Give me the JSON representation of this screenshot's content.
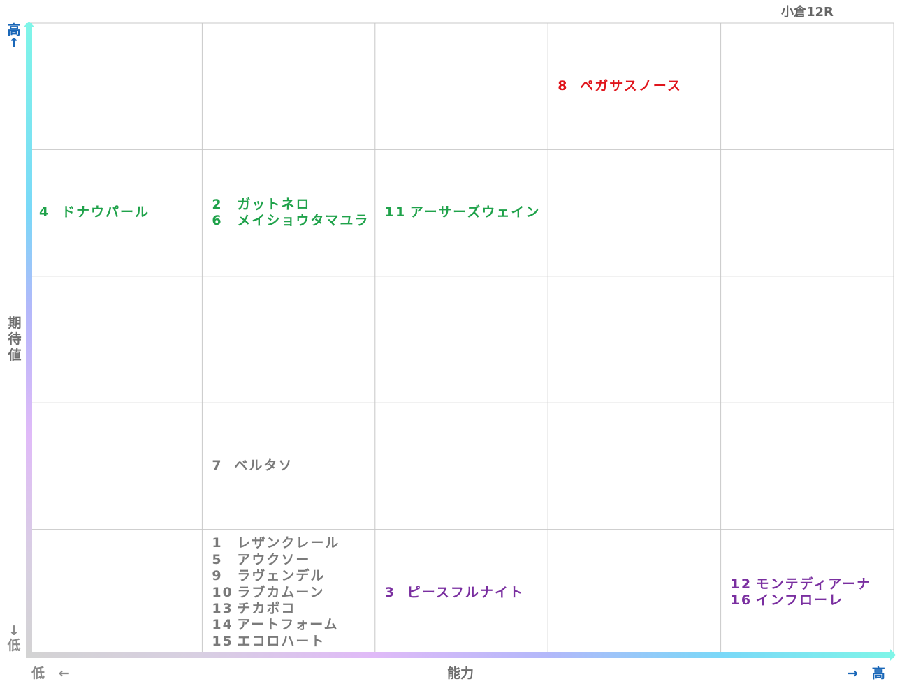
{
  "title": "小倉12R",
  "colors": {
    "green": "#1fa24a",
    "red": "#e0151c",
    "purple": "#7a2fa0",
    "gray": "#7a7a7a",
    "axis_blue": "#1a67b8",
    "grid_line": "#c8c8c8"
  },
  "axes": {
    "y_label": "期待値",
    "y_high": "高",
    "y_low": "低",
    "y_high_arrow": "↑",
    "y_low_arrow": "↓",
    "x_label": "能力",
    "x_low": "低",
    "x_high": "高",
    "x_low_arrow": "←",
    "x_high_arrow": "→"
  },
  "chart_data": {
    "type": "table",
    "title": "小倉12R",
    "xlabel": "能力",
    "ylabel": "期待値",
    "columns": 5,
    "rows": 5,
    "cells": [
      {
        "col": 4,
        "row": 1,
        "color": "red",
        "entries": [
          {
            "num": "8",
            "name": "ペガサスノース"
          }
        ]
      },
      {
        "col": 1,
        "row": 2,
        "color": "green",
        "entries": [
          {
            "num": "4",
            "name": "ドナウパール"
          }
        ]
      },
      {
        "col": 2,
        "row": 2,
        "color": "green",
        "entries": [
          {
            "num": "2",
            "name": "ガットネロ"
          },
          {
            "num": "6",
            "name": "メイショウタマユラ"
          }
        ]
      },
      {
        "col": 3,
        "row": 2,
        "color": "green",
        "entries": [
          {
            "num": "11",
            "name": "アーサーズウェイン"
          }
        ]
      },
      {
        "col": 2,
        "row": 4,
        "color": "gray",
        "entries": [
          {
            "num": "7",
            "name": "ベルタソ"
          }
        ]
      },
      {
        "col": 2,
        "row": 5,
        "color": "gray",
        "entries": [
          {
            "num": "1",
            "name": "レザンクレール"
          },
          {
            "num": "5",
            "name": "アウクソー"
          },
          {
            "num": "9",
            "name": "ラヴェンデル"
          },
          {
            "num": "10",
            "name": "ラブカムーン"
          },
          {
            "num": "13",
            "name": "チカポコ"
          },
          {
            "num": "14",
            "name": "アートフォーム"
          },
          {
            "num": "15",
            "name": "エコロハート"
          }
        ]
      },
      {
        "col": 3,
        "row": 5,
        "color": "purple",
        "entries": [
          {
            "num": "3",
            "name": "ピースフルナイト"
          }
        ]
      },
      {
        "col": 5,
        "row": 5,
        "color": "purple",
        "entries": [
          {
            "num": "12",
            "name": "モンテディアーナ"
          },
          {
            "num": "16",
            "name": "インフローレ"
          }
        ]
      }
    ]
  }
}
